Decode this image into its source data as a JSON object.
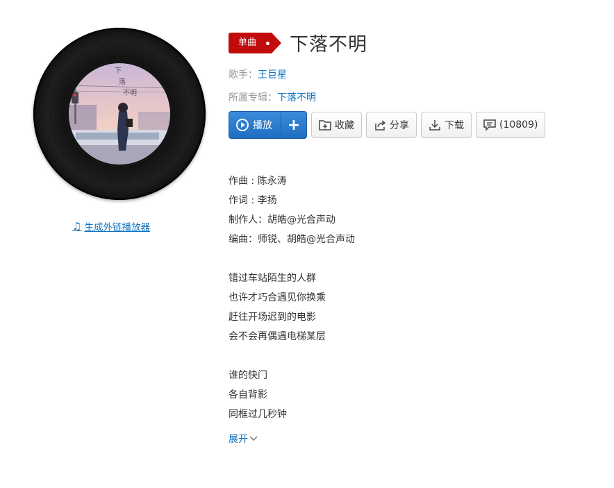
{
  "tag_label": "单曲",
  "song_title": "下落不明",
  "singer": {
    "label": "歌手：",
    "name": "王巨星"
  },
  "album": {
    "label": "所属专辑：",
    "name": "下落不明"
  },
  "buttons": {
    "play": "播放",
    "add": "+",
    "collect": "收藏",
    "share": "分享",
    "download": "下载",
    "comment": "(10809)"
  },
  "external_link": "生成外链播放器",
  "credits": [
    "作曲 : 陈永涛",
    "作词 : 李扬",
    "制作人：胡皓@光合声动",
    "编曲：师锐、胡皓@光合声动"
  ],
  "lyrics_block1": [
    "错过车站陌生的人群",
    "也许才巧合遇见你换乘",
    "赶往开场迟到的电影",
    "会不会再偶遇电梯某层"
  ],
  "lyrics_block2": [
    "谁的快门",
    "各自背影",
    "同框过几秒钟"
  ],
  "expand_label": "展开",
  "icons": {
    "play": "play-circle-icon",
    "collect": "folder-add-icon",
    "share": "share-icon",
    "download": "download-icon",
    "comment": "comment-icon",
    "note": "music-note-icon",
    "chevron": "chevron-down-icon"
  },
  "colors": {
    "accent_red": "#c20c0c",
    "link_blue": "#0c73c2",
    "play_blue": "#2a7ad2"
  }
}
